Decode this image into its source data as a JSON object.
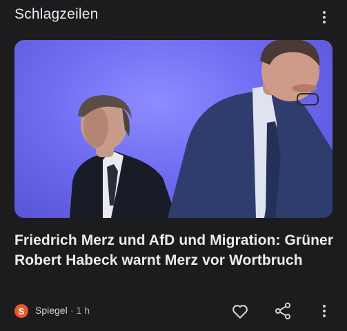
{
  "section": {
    "title": "Schlagzeilen"
  },
  "article": {
    "headline": "Friedrich Merz und AfD und Migration: Grüner Robert Habeck warnt Merz vor Wortbruch",
    "source_logo_letter": "S",
    "source": "Spiegel",
    "age": "· 1 h"
  },
  "icons": {
    "more": "more-vert-icon",
    "like": "heart-outline-icon",
    "share": "share-icon"
  },
  "colors": {
    "background": "#1c1c1e",
    "text": "#e8eaed",
    "source_logo": "#e8592b",
    "hero_backdrop": "#6f6cf2"
  }
}
